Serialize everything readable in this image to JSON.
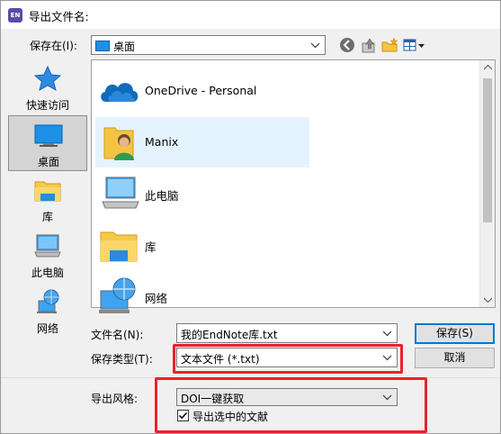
{
  "window": {
    "title": "导出文件名:"
  },
  "app_icon": {
    "text": "EN"
  },
  "toolbar": {
    "save_in_label": "保存在(I):",
    "location_value": "桌面"
  },
  "places": [
    {
      "label": "快速访问",
      "icon": "star-icon"
    },
    {
      "label": "桌面",
      "icon": "desktop-icon"
    },
    {
      "label": "库",
      "icon": "library-folder-icon"
    },
    {
      "label": "此电脑",
      "icon": "computer-icon"
    },
    {
      "label": "网络",
      "icon": "network-icon"
    }
  ],
  "files": [
    {
      "label": "OneDrive - Personal",
      "icon": "onedrive-cloud-icon"
    },
    {
      "label": "Manix",
      "icon": "user-folder-icon"
    },
    {
      "label": "此电脑",
      "icon": "computer-icon"
    },
    {
      "label": "库",
      "icon": "library-folder-icon"
    },
    {
      "label": "网络",
      "icon": "network-icon"
    }
  ],
  "form": {
    "filename_label": "文件名(N):",
    "filename_value": "我的EndNote库.txt",
    "filetype_label": "保存类型(T):",
    "filetype_value": "文本文件 (*.txt)",
    "save_button": "保存(S)",
    "cancel_button": "取消",
    "export_style_label": "导出风格:",
    "export_style_value": "DOI一键获取",
    "export_selected_label": "导出选中的文献",
    "export_selected_checked": true
  },
  "colors": {
    "highlight_box": "#e8222c",
    "selection_bg": "#e5f3ff",
    "accent": "#0078d7"
  }
}
